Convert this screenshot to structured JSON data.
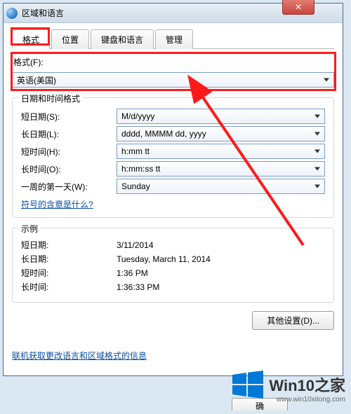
{
  "window": {
    "title": "区域和语言"
  },
  "tabs": [
    "格式",
    "位置",
    "键盘和语言",
    "管理"
  ],
  "format": {
    "label": "格式(F):",
    "value": "英语(美国)"
  },
  "datetime_section": {
    "legend": "日期和时间格式",
    "rows": [
      {
        "label": "短日期(S):",
        "value": "M/d/yyyy"
      },
      {
        "label": "长日期(L):",
        "value": "dddd, MMMM dd, yyyy"
      },
      {
        "label": "短时间(H):",
        "value": "h:mm tt"
      },
      {
        "label": "长时间(O):",
        "value": "h:mm:ss tt"
      },
      {
        "label": "一周的第一天(W):",
        "value": "Sunday"
      }
    ],
    "link": "符号的含意是什么?"
  },
  "example_section": {
    "legend": "示例",
    "rows": [
      {
        "label": "短日期:",
        "value": "3/11/2014"
      },
      {
        "label": "长日期:",
        "value": "Tuesday, March 11, 2014"
      },
      {
        "label": "短时间:",
        "value": "1:36 PM"
      },
      {
        "label": "长时间:",
        "value": "1:36:33 PM"
      }
    ]
  },
  "other_settings": "其他设置(D)...",
  "footer_link": "联机获取更改语言和区域格式的信息",
  "ok_cut": "确",
  "watermark": {
    "brand": "Win10之家",
    "url": "www.win10xitong.com"
  }
}
